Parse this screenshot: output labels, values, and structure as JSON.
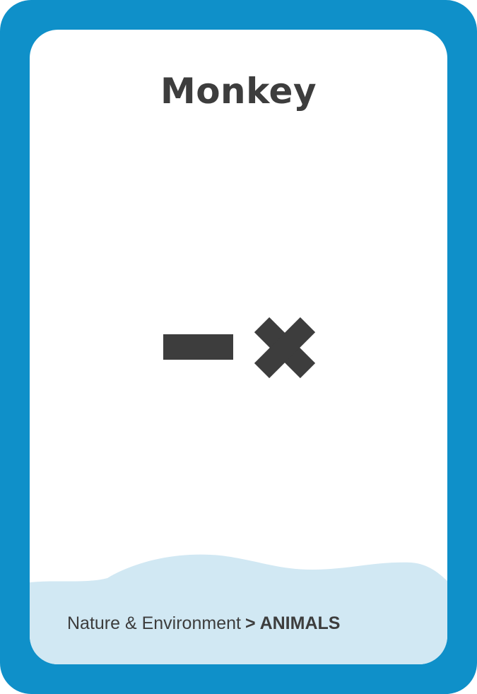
{
  "card": {
    "title": "Monkey",
    "category": "Nature & Environment",
    "separator": ">",
    "subcategory": "ANIMALS"
  },
  "icons": {
    "primary": "minus-icon",
    "secondary": "cross-icon"
  },
  "colors": {
    "frame": "#0f90c9",
    "card": "#ffffff",
    "wave": "#d1e8f3",
    "text": "#3d3d3d"
  }
}
